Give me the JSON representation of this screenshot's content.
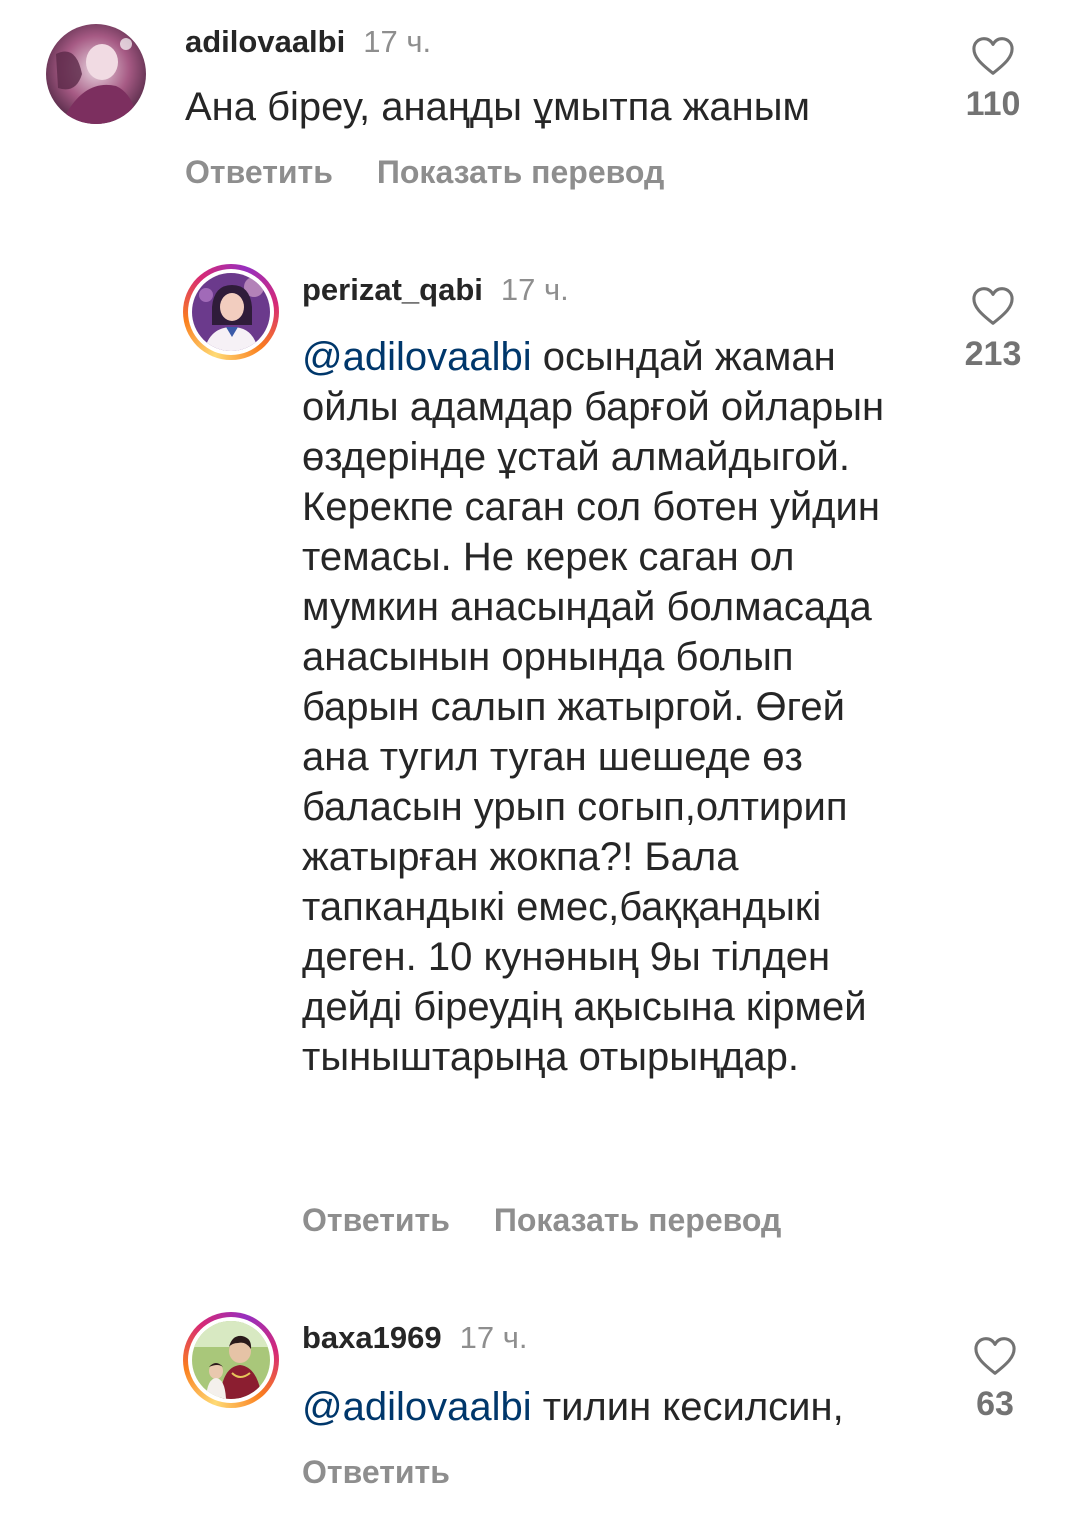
{
  "comments": [
    {
      "username": "adilovaalbi",
      "time": "17 ч.",
      "mention": "",
      "text": "Ана біреу,  анаңды ұмытпа жаным",
      "likes": "110",
      "reply_label": "Ответить",
      "translate_label": "Показать перевод",
      "avatar_colors": [
        "#9a4a74",
        "#d9b9c9",
        "#5c2d4d"
      ]
    },
    {
      "username": "perizat_qabi",
      "time": "17 ч.",
      "mention": "@adilovaalbi",
      "text": " осындай жаман ойлы адамдар барғой ойларын өздерінде ұстай алмайдыгой. Керекпе саган сол ботен уйдин темасы. Не керек саган ол мумкин анасындай болмасада анасынын орнында болып барын салып жатыргой. Өгей ана тугил туган шешеде өз баласын урып согып,олтирип жатырған жокпа?! Бала тапкандыкі емес,баққандыкі деген. 10 кунәның 9ы тілден дейді біреудің ақысына кірмей тыныштарыңа отырыңдар.",
      "likes": "213",
      "reply_label": "Ответить",
      "translate_label": "Показать перевод",
      "avatar_colors": [
        "#7b3fa0",
        "#e9a3c4",
        "#3a2250"
      ]
    },
    {
      "username": "baxa1969",
      "time": "17 ч.",
      "mention": "@adilovaalbi",
      "text": " тилин кесилсин,",
      "likes": "63",
      "reply_label": "Ответить",
      "translate_label": "",
      "avatar_colors": [
        "#9cb86a",
        "#8b2a3a",
        "#e6d8cf"
      ]
    }
  ],
  "icons": {
    "like": "heart-outline-icon"
  }
}
